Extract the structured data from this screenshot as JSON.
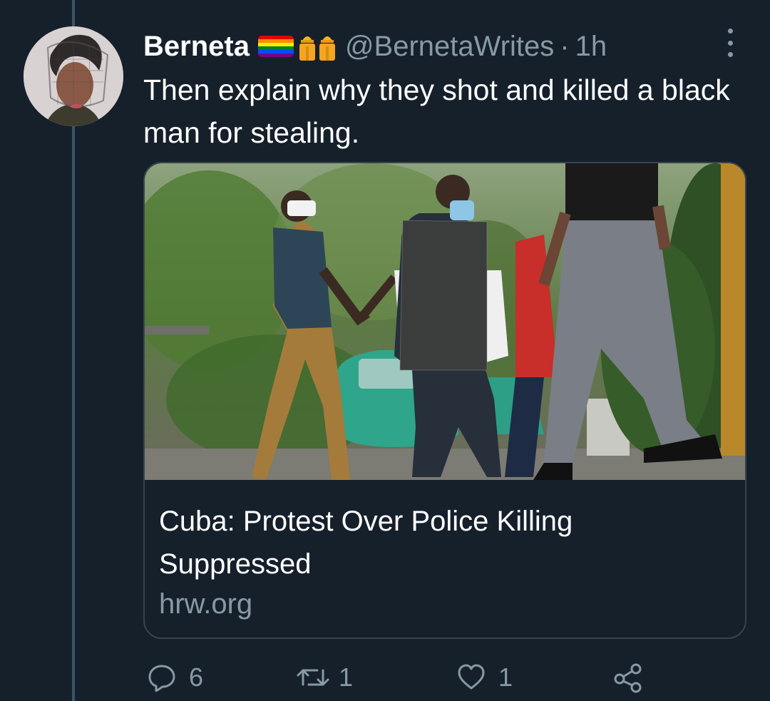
{
  "tweet": {
    "display_name": "Berneta",
    "handle": "@BernetaWrites",
    "separator": "·",
    "time": "1h",
    "text": "Then explain why they shot and killed a black man for stealing.",
    "emoji": [
      "rainbow-flag-icon",
      "construction-workers-icon"
    ]
  },
  "card": {
    "title": "Cuba: Protest Over Police Killing Suppressed",
    "domain": "hrw.org"
  },
  "actions": {
    "reply_count": "6",
    "retweet_count": "1",
    "like_count": "1"
  },
  "colors": {
    "background": "#15202b",
    "border": "#38444d",
    "secondary_text": "#8899a6",
    "thread_line": "#3d5466"
  }
}
